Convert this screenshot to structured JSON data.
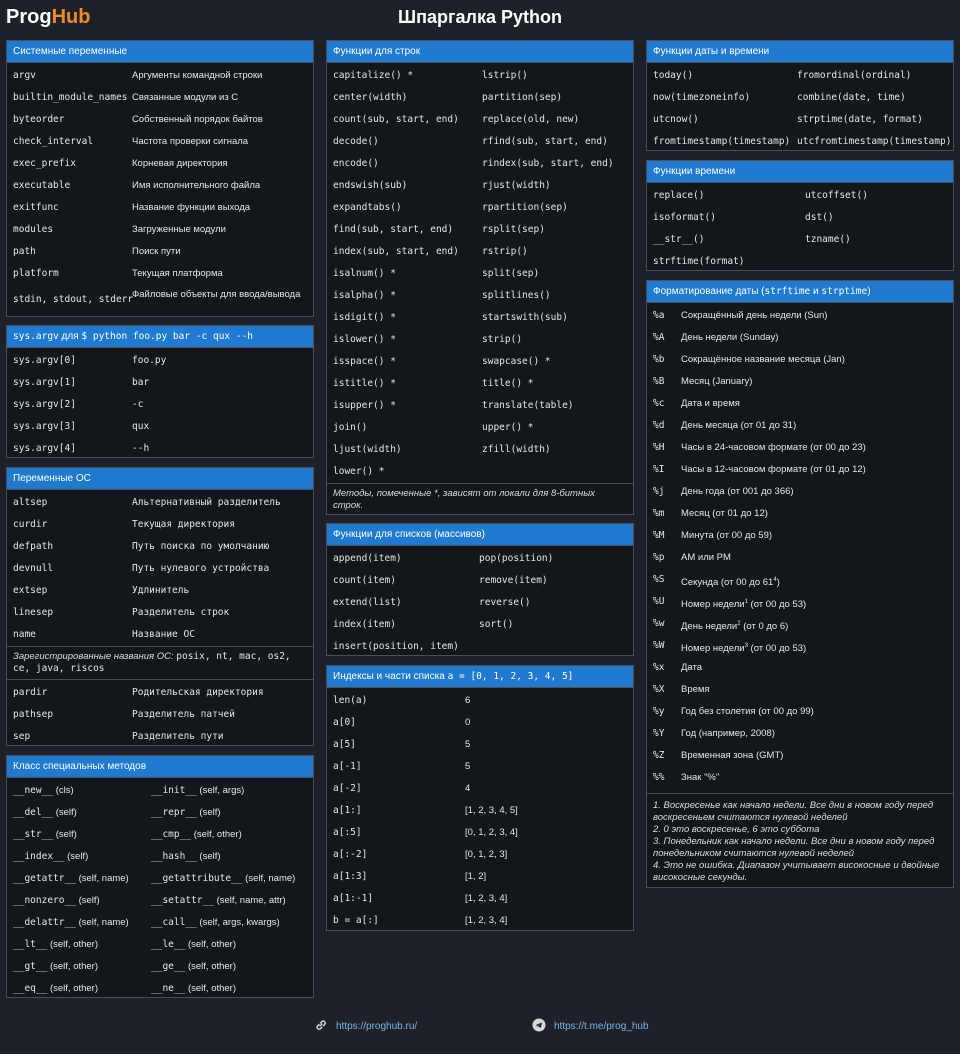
{
  "header": {
    "logo_prog": "Prog",
    "logo_hub": "Hub",
    "title": "Шпаргалка Python"
  },
  "sys_vars": {
    "title": "Системные переменные",
    "rows": [
      [
        "argv",
        "Аргументы командной строки"
      ],
      [
        "builtin_module_names",
        "Связанные модули из C"
      ],
      [
        "byteorder",
        "Собственный порядок байтов"
      ],
      [
        "check_interval",
        "Частота проверки сигнала"
      ],
      [
        "exec_prefix",
        "Корневая директория"
      ],
      [
        "executable",
        "Имя исполнительного файла"
      ],
      [
        "exitfunc",
        "Название функции выхода"
      ],
      [
        "modules",
        "Загруженные модули"
      ],
      [
        "path",
        "Поиск пути"
      ],
      [
        "platform",
        "Текущая платформа"
      ],
      [
        "stdin, stdout, stderr",
        "Файловые объекты для ввода/вывода"
      ]
    ]
  },
  "sys_argv": {
    "title_code": "sys.argv",
    "title_text": " для ",
    "title_cmd": "$ python foo.py bar -c qux --h",
    "rows": [
      [
        "sys.argv[0]",
        "foo.py"
      ],
      [
        "sys.argv[1]",
        "bar"
      ],
      [
        "sys.argv[2]",
        "-c"
      ],
      [
        "sys.argv[3]",
        "qux"
      ],
      [
        "sys.argv[4]",
        "--h"
      ]
    ]
  },
  "os_vars": {
    "title": "Переменные ОС",
    "rows": [
      [
        "altsep",
        "Альтернативный разделитель"
      ],
      [
        "curdir",
        "Текущая директория"
      ],
      [
        "defpath",
        "Путь поиска по умолчанию"
      ],
      [
        "devnull",
        "Путь нулевого устройства"
      ],
      [
        "extsep",
        "Удлинитель"
      ],
      [
        "linesep",
        "Разделитель строк"
      ],
      [
        "name",
        "Название ОС"
      ]
    ],
    "note_text": "Зарегистрированные названия ОС: ",
    "note_code": "posix, nt, mac, os2, ce, java, riscos",
    "rows2": [
      [
        "pardir",
        "Родительская директория"
      ],
      [
        "pathsep",
        "Разделитель патчей"
      ],
      [
        "sep",
        "Разделитель пути"
      ]
    ]
  },
  "special_methods": {
    "title": "Класс специальных методов",
    "rows": [
      [
        "__new__",
        "(cls)",
        "__init__",
        "(self, args)"
      ],
      [
        "__del__",
        "(self)",
        "__repr__",
        "(self)"
      ],
      [
        "__str__",
        "(self)",
        "__cmp__",
        "(self, other)"
      ],
      [
        "__index__",
        "(self)",
        "__hash__",
        "(self)"
      ],
      [
        "__getattr__",
        "(self, name)",
        "__getattribute__",
        "(self, name)"
      ],
      [
        "__nonzero__",
        "(self)",
        "__setattr__",
        "(self, name, attr)"
      ],
      [
        "__delattr__",
        "(self, name)",
        "__call__",
        "(self, args, kwargs)"
      ],
      [
        "__lt__",
        "(self, other)",
        "__le__",
        "(self, other)"
      ],
      [
        "__gt__",
        "(self, other)",
        "__ge__",
        "(self, other)"
      ],
      [
        "__eq__",
        "(self, other)",
        "__ne__",
        "(self, other)"
      ]
    ]
  },
  "string_funcs": {
    "title": "Функции для строк",
    "rows": [
      [
        "capitalize() *",
        "lstrip()"
      ],
      [
        "center(width)",
        "partition(sep)"
      ],
      [
        "count(sub, start, end)",
        "replace(old, new)"
      ],
      [
        "decode()",
        "rfind(sub, start, end)"
      ],
      [
        "encode()",
        "rindex(sub, start, end)"
      ],
      [
        "endswish(sub)",
        "rjust(width)"
      ],
      [
        "expandtabs()",
        "rpartition(sep)"
      ],
      [
        "find(sub, start, end)",
        "rsplit(sep)"
      ],
      [
        "index(sub, start, end)",
        "rstrip()"
      ],
      [
        "isalnum() *",
        "split(sep)"
      ],
      [
        "isalpha() *",
        "splitlines()"
      ],
      [
        "isdigit() *",
        "startswith(sub)"
      ],
      [
        "islower() *",
        "strip()"
      ],
      [
        "isspace() *",
        "swapcase() *"
      ],
      [
        "istitle() *",
        "title() *"
      ],
      [
        "isupper() *",
        "translate(table)"
      ],
      [
        "join()",
        "upper() *"
      ],
      [
        "ljust(width)",
        "zfill(width)"
      ],
      [
        "lower() *",
        ""
      ]
    ],
    "note": "Методы, помеченные *, зависят от локали для 8-битных строк."
  },
  "list_funcs": {
    "title": "Функции для списков (массивов)",
    "rows": [
      [
        "append(item)",
        "pop(position)"
      ],
      [
        "count(item)",
        "remove(item)"
      ],
      [
        "extend(list)",
        "reverse()"
      ],
      [
        "index(item)",
        "sort()"
      ],
      [
        "insert(position, item)",
        ""
      ]
    ]
  },
  "indexes": {
    "title_text": "Индексы и части списка ",
    "title_code": "a = [0, 1, 2, 3, 4, 5]",
    "rows": [
      [
        "len(a)",
        "6"
      ],
      [
        "a[0]",
        "0"
      ],
      [
        "a[5]",
        "5"
      ],
      [
        "a[-1]",
        "5"
      ],
      [
        "a[-2]",
        "4"
      ],
      [
        "a[1:]",
        "[1, 2, 3, 4, 5]"
      ],
      [
        "a[:5]",
        "[0, 1, 2, 3, 4]"
      ],
      [
        "a[:-2]",
        "[0, 1, 2, 3]"
      ],
      [
        "a[1:3]",
        "[1, 2]"
      ],
      [
        "a[1:-1]",
        "[1, 2, 3, 4]"
      ],
      [
        "b = a[:]",
        "[1, 2, 3, 4]"
      ]
    ]
  },
  "date_funcs": {
    "title": "Функции даты и времени",
    "rows": [
      [
        "today()",
        "fromordinal(ordinal)"
      ],
      [
        "now(timezoneinfo)",
        "combine(date, time)"
      ],
      [
        "utcnow()",
        "strptime(date, format)"
      ],
      [
        "fromtimestamp(timestamp)",
        "utcfromtimestamp(timestamp)"
      ]
    ]
  },
  "time_funcs": {
    "title": "Функции времени",
    "rows": [
      [
        "replace()",
        "utcoffset()"
      ],
      [
        "isoformat()",
        "dst()"
      ],
      [
        "__str__()",
        "tzname()"
      ],
      [
        "strftime(format)",
        ""
      ]
    ]
  },
  "date_format": {
    "title_a": "Форматирование даты (",
    "title_c1": "strftime",
    "title_b": " и ",
    "title_c2": "strptime",
    "title_d": ")",
    "rows": [
      {
        "code": "%a",
        "text": "Сокращённый день недели (Sun)"
      },
      {
        "code": "%A",
        "text": "День недели (Sunday)"
      },
      {
        "code": "%b",
        "text": "Сокращённое название месяца (Jan)"
      },
      {
        "code": "%B",
        "text": "Месяц (January)"
      },
      {
        "code": "%c",
        "text": "Дата и время"
      },
      {
        "code": "%d",
        "text": "День месяца (от 01 до 31)"
      },
      {
        "code": "%H",
        "text": "Часы в 24-часовом формате (от 00 до 23)"
      },
      {
        "code": "%I",
        "text": "Часы в 12-часовом формате (от 01 до 12)"
      },
      {
        "code": "%j",
        "text": "День года (от 001 до 366)"
      },
      {
        "code": "%m",
        "text": "Месяц (от 01 до 12)"
      },
      {
        "code": "%M",
        "text": "Минута (от 00 до 59)"
      },
      {
        "code": "%p",
        "text": "AM или PM"
      },
      {
        "code": "%S",
        "text": "Секунда (от 00 до 61",
        "sup": "4",
        "tail": ")"
      },
      {
        "code": "%U",
        "text": "Номер недели",
        "sup": "1",
        "tail": " (от 00 до 53)"
      },
      {
        "code": "%w",
        "text": "День недели",
        "sup": "2",
        "tail": " (от 0 до 6)"
      },
      {
        "code": "%W",
        "text": "Номер недели",
        "sup": "3",
        "tail": " (от 00 до 53)"
      },
      {
        "code": "%x",
        "text": "Дата"
      },
      {
        "code": "%X",
        "text": "Время"
      },
      {
        "code": "%y",
        "text": "Год без столетия (от 00 до 99)"
      },
      {
        "code": "%Y",
        "text": "Год (например, 2008)"
      },
      {
        "code": "%Z",
        "text": "Временная зона (GMT)"
      },
      {
        "code": "%%",
        "text": "Знак \"%\""
      }
    ],
    "notes": [
      "1. Воскресенье как начало недели. Все дни в новом году перед воскресеньем считаются нулевой неделей",
      "2. 0 это воскресенье, 6 это суббота",
      "3. Понедельник как начало недели. Все дни в новом году перед понедельником считаются нулевой неделей",
      "4. Это не ошибка. Диапазон учитывает високосные и двойные високосные секунды."
    ]
  },
  "footer": {
    "site": "https://proghub.ru/",
    "telegram": "https://t.me/prog_hub"
  }
}
